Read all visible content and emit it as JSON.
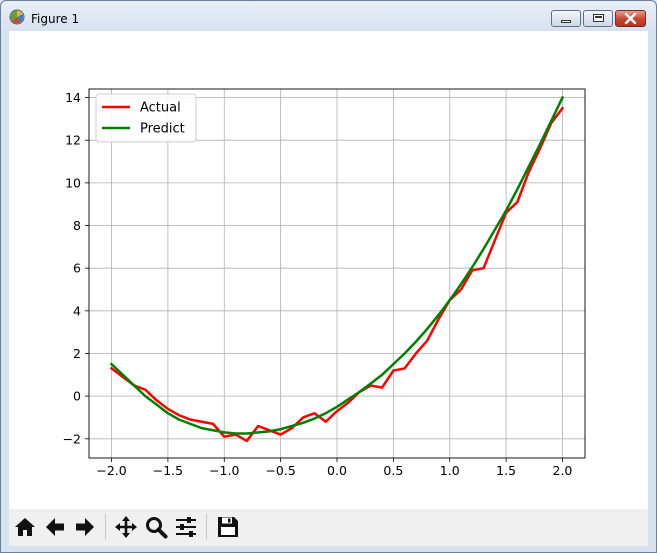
{
  "window": {
    "title": "Figure 1"
  },
  "icons": {
    "app": "matplotlib-icon",
    "minimize": "minimize-icon",
    "maximize": "maximize-icon",
    "close": "close-icon",
    "home": "home-icon",
    "back": "arrow-left-icon",
    "forward": "arrow-right-icon",
    "pan": "move-icon",
    "zoom": "magnifier-icon",
    "configure": "sliders-icon",
    "save": "floppy-disk-icon"
  },
  "chart_data": {
    "type": "line",
    "title": "",
    "xlabel": "",
    "ylabel": "",
    "xlim": [
      -2.2,
      2.2
    ],
    "ylim": [
      -2.9,
      14.4
    ],
    "xticks": [
      -2.0,
      -1.5,
      -1.0,
      -0.5,
      0.0,
      0.5,
      1.0,
      1.5,
      2.0
    ],
    "xtick_labels": [
      "−2.0",
      "−1.5",
      "−1.0",
      "−0.5",
      "0.0",
      "0.5",
      "1.0",
      "1.5",
      "2.0"
    ],
    "yticks": [
      -2,
      0,
      2,
      4,
      6,
      8,
      10,
      12,
      14
    ],
    "ytick_labels": [
      "−2",
      "0",
      "2",
      "4",
      "6",
      "8",
      "10",
      "12",
      "14"
    ],
    "grid": true,
    "legend": "upper-left",
    "series": [
      {
        "name": "Actual",
        "color": "#ff0000",
        "x": [
          -2.0,
          -1.9,
          -1.8,
          -1.7,
          -1.6,
          -1.5,
          -1.4,
          -1.3,
          -1.2,
          -1.1,
          -1.0,
          -0.9,
          -0.8,
          -0.7,
          -0.6,
          -0.5,
          -0.4,
          -0.3,
          -0.2,
          -0.1,
          0.0,
          0.1,
          0.2,
          0.3,
          0.4,
          0.5,
          0.6,
          0.7,
          0.8,
          0.9,
          1.0,
          1.1,
          1.2,
          1.3,
          1.4,
          1.5,
          1.6,
          1.7,
          1.8,
          1.9,
          2.0
        ],
        "y": [
          1.3,
          0.9,
          0.5,
          0.3,
          -0.2,
          -0.6,
          -0.9,
          -1.1,
          -1.2,
          -1.3,
          -1.9,
          -1.8,
          -2.1,
          -1.4,
          -1.6,
          -1.8,
          -1.5,
          -1.0,
          -0.8,
          -1.2,
          -0.7,
          -0.3,
          0.2,
          0.5,
          0.4,
          1.2,
          1.3,
          2.0,
          2.6,
          3.6,
          4.5,
          5.0,
          5.9,
          6.0,
          7.3,
          8.6,
          9.1,
          10.5,
          11.6,
          12.8,
          13.5
        ]
      },
      {
        "name": "Predict",
        "color": "#008000",
        "x": [
          -2.0,
          -1.9,
          -1.8,
          -1.7,
          -1.6,
          -1.5,
          -1.4,
          -1.3,
          -1.2,
          -1.1,
          -1.0,
          -0.9,
          -0.8,
          -0.7,
          -0.6,
          -0.5,
          -0.4,
          -0.3,
          -0.2,
          -0.1,
          0.0,
          0.1,
          0.2,
          0.3,
          0.4,
          0.5,
          0.6,
          0.7,
          0.8,
          0.9,
          1.0,
          1.1,
          1.2,
          1.3,
          1.4,
          1.5,
          1.6,
          1.7,
          1.8,
          1.9,
          2.0
        ],
        "y": [
          1.5,
          1.0,
          0.5,
          0.0,
          -0.4,
          -0.8,
          -1.1,
          -1.3,
          -1.5,
          -1.6,
          -1.7,
          -1.75,
          -1.75,
          -1.7,
          -1.65,
          -1.55,
          -1.4,
          -1.25,
          -1.05,
          -0.8,
          -0.5,
          -0.15,
          0.2,
          0.6,
          1.0,
          1.5,
          2.0,
          2.55,
          3.15,
          3.8,
          4.5,
          5.25,
          6.05,
          6.9,
          7.8,
          8.7,
          9.7,
          10.75,
          11.8,
          12.9,
          14.0
        ]
      }
    ]
  }
}
